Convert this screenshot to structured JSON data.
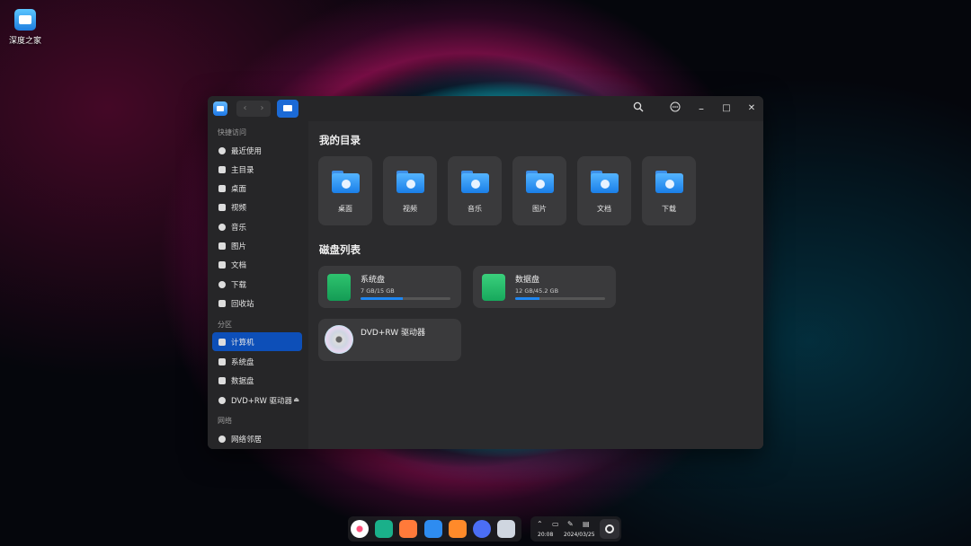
{
  "desktop": {
    "icons": [
      {
        "label": "深度之家",
        "icon": "deepin-home-icon"
      }
    ]
  },
  "window": {
    "title_icon": "file-manager-icon",
    "nav": {
      "back": "‹",
      "forward": "›"
    },
    "breadcrumb_icon": "computer-icon",
    "toolbar": {
      "search_icon": "search-icon",
      "menu_icon": "menu-icon",
      "minimize": "–",
      "maximize": "□",
      "close": "✕"
    }
  },
  "sidebar": {
    "sections": [
      {
        "title": "快捷访问"
      },
      {
        "title": "分区"
      },
      {
        "title": "网络"
      }
    ],
    "quick_access": [
      {
        "label": "最近使用",
        "icon": "clock-icon"
      },
      {
        "label": "主目录",
        "icon": "home-icon"
      },
      {
        "label": "桌面",
        "icon": "desktop-icon"
      },
      {
        "label": "视频",
        "icon": "video-icon"
      },
      {
        "label": "音乐",
        "icon": "music-icon"
      },
      {
        "label": "图片",
        "icon": "picture-icon"
      },
      {
        "label": "文档",
        "icon": "document-icon"
      },
      {
        "label": "下载",
        "icon": "download-icon"
      },
      {
        "label": "回收站",
        "icon": "trash-icon"
      }
    ],
    "partitions": [
      {
        "label": "计算机",
        "icon": "computer-icon",
        "active": true
      },
      {
        "label": "系统盘",
        "icon": "disk-icon"
      },
      {
        "label": "数据盘",
        "icon": "disk-icon"
      },
      {
        "label": "DVD+RW 驱动器",
        "icon": "dvd-icon",
        "eject": "⏏"
      }
    ],
    "network": [
      {
        "label": "网络邻居",
        "icon": "network-icon"
      }
    ]
  },
  "main": {
    "my_directory_title": "我的目录",
    "folders": [
      {
        "label": "桌面",
        "icon": "desktop-folder-icon",
        "color": "#1f86f0"
      },
      {
        "label": "视频",
        "icon": "video-folder-icon",
        "color": "#1f86f0"
      },
      {
        "label": "音乐",
        "icon": "music-folder-icon",
        "color": "#1f86f0"
      },
      {
        "label": "图片",
        "icon": "picture-folder-icon",
        "color": "#1f86f0"
      },
      {
        "label": "文档",
        "icon": "document-folder-icon",
        "color": "#1f86f0"
      },
      {
        "label": "下载",
        "icon": "download-folder-icon",
        "color": "#1f86f0"
      }
    ],
    "disk_list_title": "磁盘列表",
    "disks": [
      {
        "name": "系统盘",
        "size": "7 GB/15 GB",
        "usage": 0.47,
        "color": "#1faa5a"
      },
      {
        "name": "数据盘",
        "size": "12 GB/45.2 GB",
        "usage": 0.27,
        "color": "#22c06a"
      }
    ],
    "dvd": {
      "name": "DVD+RW 驱动器"
    }
  },
  "dock": {
    "apps": [
      {
        "name": "launcher-icon",
        "color": "#ffffff"
      },
      {
        "name": "terminal-icon",
        "color": "#1ab08a"
      },
      {
        "name": "app-store-icon",
        "color": "#ff7a3a"
      },
      {
        "name": "file-manager-icon",
        "color": "#2e8cf0"
      },
      {
        "name": "archive-icon",
        "color": "#ff8a2a"
      },
      {
        "name": "settings-icon",
        "color": "#4b6ef5"
      },
      {
        "name": "trash-icon",
        "color": "#cfd6e0"
      }
    ],
    "tray": {
      "time": "20:08",
      "date": "2024/03/25"
    }
  }
}
